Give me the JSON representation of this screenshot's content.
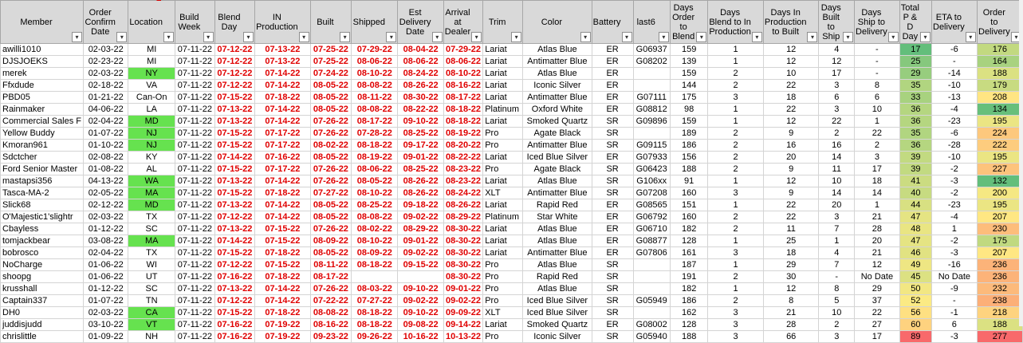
{
  "headers": [
    {
      "label": "Member",
      "filter": "▾"
    },
    {
      "label": "Order Confirm Date",
      "filter": "▾"
    },
    {
      "label": "Location",
      "filter": "▾"
    },
    {
      "label": "Build Week",
      "filter": "▾"
    },
    {
      "label": "Blend Day",
      "filter": "▾"
    },
    {
      "label": "IN Production",
      "filter": "▾"
    },
    {
      "label": "Built",
      "filter": "▾"
    },
    {
      "label": "Shipped",
      "filter": "▾"
    },
    {
      "label": "Est Delivery Date",
      "filter": "▾"
    },
    {
      "label": "Arrival at Dealer",
      "filter": "▾"
    },
    {
      "label": "Trim",
      "filter": "▾"
    },
    {
      "label": "Color",
      "filter": "▾"
    },
    {
      "label": "Battery",
      "filter": "▾"
    },
    {
      "label": "last6",
      "filter": "▾"
    },
    {
      "label": "Days Order to Blend",
      "filter": "▾"
    },
    {
      "label": "Days Blend to In Production",
      "filter": "▾"
    },
    {
      "label": "Days In Production to Built",
      "filter": "▾"
    },
    {
      "label": "Days Built to Ship",
      "filter": "▾"
    },
    {
      "label": "Days Ship to Delivery",
      "filter": "▾"
    },
    {
      "label": "Total P & D Day",
      "filter": "▾"
    },
    {
      "label": "ETA to Delivery",
      "filter": "▾"
    },
    {
      "label": "Order to Delivery",
      "filter": "▾"
    }
  ],
  "colors": {
    "red_text": "#e00000",
    "location_highlight": "#66e24f",
    "header_bg": "#d9d9d9"
  },
  "rows": [
    {
      "member": "awilli1010",
      "order": "02-03-22",
      "loc": "MI",
      "loc_hl": false,
      "week": "07-11-22",
      "blend": "07-12-22",
      "inprod": "07-13-22",
      "built": "07-25-22",
      "shipped": "07-29-22",
      "est": "08-04-22",
      "arrival": "07-29-22",
      "trim": "Lariat",
      "color": "Atlas Blue",
      "battery": "ER",
      "last6": "G06937",
      "d_order_blend": "159",
      "d_blend_prod": "1",
      "d_prod_built": "12",
      "d_built_ship": "4",
      "d_ship_del": "-",
      "total": "17",
      "eta": "-6",
      "otd": "176"
    },
    {
      "member": "DJSJOEKS",
      "order": "02-23-22",
      "loc": "MI",
      "loc_hl": false,
      "week": "07-11-22",
      "blend": "07-12-22",
      "inprod": "07-13-22",
      "built": "07-25-22",
      "shipped": "08-06-22",
      "est": "08-06-22",
      "arrival": "08-06-22",
      "trim": "Lariat",
      "color": "Antimatter Blue",
      "battery": "ER",
      "last6": "G08202",
      "d_order_blend": "139",
      "d_blend_prod": "1",
      "d_prod_built": "12",
      "d_built_ship": "12",
      "d_ship_del": "-",
      "total": "25",
      "eta": "-",
      "otd": "164"
    },
    {
      "member": "merek",
      "order": "02-03-22",
      "loc": "NY",
      "loc_hl": true,
      "week": "07-11-22",
      "blend": "07-12-22",
      "inprod": "07-14-22",
      "built": "07-24-22",
      "shipped": "08-10-22",
      "est": "08-24-22",
      "arrival": "08-10-22",
      "trim": "Lariat",
      "color": "Atlas Blue",
      "battery": "ER",
      "last6": "",
      "d_order_blend": "159",
      "d_blend_prod": "2",
      "d_prod_built": "10",
      "d_built_ship": "17",
      "d_ship_del": "-",
      "total": "29",
      "eta": "-14",
      "otd": "188"
    },
    {
      "member": "Ffxdude",
      "order": "02-18-22",
      "loc": "VA",
      "loc_hl": false,
      "week": "07-11-22",
      "blend": "07-12-22",
      "inprod": "07-14-22",
      "built": "08-05-22",
      "shipped": "08-08-22",
      "est": "08-26-22",
      "arrival": "08-16-22",
      "trim": "Lariat",
      "color": "Iconic Silver",
      "battery": "ER",
      "last6": "",
      "d_order_blend": "144",
      "d_blend_prod": "2",
      "d_prod_built": "22",
      "d_built_ship": "3",
      "d_ship_del": "8",
      "total": "35",
      "eta": "-10",
      "otd": "179"
    },
    {
      "member": "PBD05",
      "order": "01-21-22",
      "loc": "Can-On",
      "loc_hl": false,
      "week": "07-11-22",
      "blend": "07-15-22",
      "inprod": "07-18-22",
      "built": "08-05-22",
      "shipped": "08-11-22",
      "est": "08-30-22",
      "arrival": "08-17-22",
      "trim": "Lariat",
      "color": "Antimatter Blue",
      "battery": "ER",
      "last6": "G07111",
      "d_order_blend": "175",
      "d_blend_prod": "3",
      "d_prod_built": "18",
      "d_built_ship": "6",
      "d_ship_del": "6",
      "total": "33",
      "eta": "-13",
      "otd": "208"
    },
    {
      "member": "Rainmaker",
      "order": "04-06-22",
      "loc": "LA",
      "loc_hl": false,
      "week": "07-11-22",
      "blend": "07-13-22",
      "inprod": "07-14-22",
      "built": "08-05-22",
      "shipped": "08-08-22",
      "est": "08-22-22",
      "arrival": "08-18-22",
      "trim": "Platinum",
      "color": "Oxford White",
      "battery": "ER",
      "last6": "G08812",
      "d_order_blend": "98",
      "d_blend_prod": "1",
      "d_prod_built": "22",
      "d_built_ship": "3",
      "d_ship_del": "10",
      "total": "36",
      "eta": "-4",
      "otd": "134"
    },
    {
      "member": "Commercial Sales F",
      "order": "02-04-22",
      "loc": "MD",
      "loc_hl": true,
      "week": "07-11-22",
      "blend": "07-13-22",
      "inprod": "07-14-22",
      "built": "07-26-22",
      "shipped": "08-17-22",
      "est": "09-10-22",
      "arrival": "08-18-22",
      "trim": "Lariat",
      "color": "Smoked Quartz",
      "battery": "SR",
      "last6": "G09896",
      "d_order_blend": "159",
      "d_blend_prod": "1",
      "d_prod_built": "12",
      "d_built_ship": "22",
      "d_ship_del": "1",
      "total": "36",
      "eta": "-23",
      "otd": "195"
    },
    {
      "member": "Yellow Buddy",
      "order": "01-07-22",
      "loc": "NJ",
      "loc_hl": true,
      "week": "07-11-22",
      "blend": "07-15-22",
      "inprod": "07-17-22",
      "built": "07-26-22",
      "shipped": "07-28-22",
      "est": "08-25-22",
      "arrival": "08-19-22",
      "trim": "Pro",
      "color": "Agate Black",
      "battery": "SR",
      "last6": "",
      "d_order_blend": "189",
      "d_blend_prod": "2",
      "d_prod_built": "9",
      "d_built_ship": "2",
      "d_ship_del": "22",
      "total": "35",
      "eta": "-6",
      "otd": "224"
    },
    {
      "member": "Kmoran961",
      "order": "01-10-22",
      "loc": "NJ",
      "loc_hl": true,
      "week": "07-11-22",
      "blend": "07-15-22",
      "inprod": "07-17-22",
      "built": "08-02-22",
      "shipped": "08-18-22",
      "est": "09-17-22",
      "arrival": "08-20-22",
      "trim": "Pro",
      "color": "Antimatter Blue",
      "battery": "SR",
      "last6": "G09115",
      "d_order_blend": "186",
      "d_blend_prod": "2",
      "d_prod_built": "16",
      "d_built_ship": "16",
      "d_ship_del": "2",
      "total": "36",
      "eta": "-28",
      "otd": "222"
    },
    {
      "member": "Sdctcher",
      "order": "02-08-22",
      "loc": "KY",
      "loc_hl": false,
      "week": "07-11-22",
      "blend": "07-14-22",
      "inprod": "07-16-22",
      "built": "08-05-22",
      "shipped": "08-19-22",
      "est": "09-01-22",
      "arrival": "08-22-22",
      "trim": "Lariat",
      "color": "Iced Blue Silver",
      "battery": "ER",
      "last6": "G07933",
      "d_order_blend": "156",
      "d_blend_prod": "2",
      "d_prod_built": "20",
      "d_built_ship": "14",
      "d_ship_del": "3",
      "total": "39",
      "eta": "-10",
      "otd": "195"
    },
    {
      "member": "Ford Senior Master",
      "order": "01-08-22",
      "loc": "AL",
      "loc_hl": false,
      "week": "07-11-22",
      "blend": "07-15-22",
      "inprod": "07-17-22",
      "built": "07-26-22",
      "shipped": "08-06-22",
      "est": "08-25-22",
      "arrival": "08-23-22",
      "trim": "Pro",
      "color": "Agate Black",
      "battery": "SR",
      "last6": "G06423",
      "d_order_blend": "188",
      "d_blend_prod": "2",
      "d_prod_built": "9",
      "d_built_ship": "11",
      "d_ship_del": "17",
      "total": "39",
      "eta": "-2",
      "otd": "227"
    },
    {
      "member": "mastapsi356",
      "order": "04-13-22",
      "loc": "WA",
      "loc_hl": true,
      "week": "07-11-22",
      "blend": "07-13-22",
      "inprod": "07-14-22",
      "built": "07-26-22",
      "shipped": "08-05-22",
      "est": "08-26-22",
      "arrival": "08-23-22",
      "trim": "Lariat",
      "color": "Atlas Blue",
      "battery": "SR",
      "last6": "G106xx",
      "d_order_blend": "91",
      "d_blend_prod": "1",
      "d_prod_built": "12",
      "d_built_ship": "10",
      "d_ship_del": "18",
      "total": "41",
      "eta": "-3",
      "otd": "132"
    },
    {
      "member": "Tasca-MA-2",
      "order": "02-05-22",
      "loc": "MA",
      "loc_hl": true,
      "week": "07-11-22",
      "blend": "07-15-22",
      "inprod": "07-18-22",
      "built": "07-27-22",
      "shipped": "08-10-22",
      "est": "08-26-22",
      "arrival": "08-24-22",
      "trim": "XLT",
      "color": "Antimatter Blue",
      "battery": "SR",
      "last6": "G07208",
      "d_order_blend": "160",
      "d_blend_prod": "3",
      "d_prod_built": "9",
      "d_built_ship": "14",
      "d_ship_del": "14",
      "total": "40",
      "eta": "-2",
      "otd": "200"
    },
    {
      "member": "Slick68",
      "order": "02-12-22",
      "loc": "MD",
      "loc_hl": true,
      "week": "07-11-22",
      "blend": "07-13-22",
      "inprod": "07-14-22",
      "built": "08-05-22",
      "shipped": "08-25-22",
      "est": "09-18-22",
      "arrival": "08-26-22",
      "trim": "Lariat",
      "color": "Rapid Red",
      "battery": "ER",
      "last6": "G08565",
      "d_order_blend": "151",
      "d_blend_prod": "1",
      "d_prod_built": "22",
      "d_built_ship": "20",
      "d_ship_del": "1",
      "total": "44",
      "eta": "-23",
      "otd": "195"
    },
    {
      "member": "O'Majestic1'slightr",
      "order": "02-03-22",
      "loc": "TX",
      "loc_hl": false,
      "week": "07-11-22",
      "blend": "07-12-22",
      "inprod": "07-14-22",
      "built": "08-05-22",
      "shipped": "08-08-22",
      "est": "09-02-22",
      "arrival": "08-29-22",
      "trim": "Platinum",
      "color": "Star White",
      "battery": "ER",
      "last6": "G06792",
      "d_order_blend": "160",
      "d_blend_prod": "2",
      "d_prod_built": "22",
      "d_built_ship": "3",
      "d_ship_del": "21",
      "total": "47",
      "eta": "-4",
      "otd": "207"
    },
    {
      "member": "Cbayless",
      "order": "01-12-22",
      "loc": "SC",
      "loc_hl": false,
      "week": "07-11-22",
      "blend": "07-13-22",
      "inprod": "07-15-22",
      "built": "07-26-22",
      "shipped": "08-02-22",
      "est": "08-29-22",
      "arrival": "08-30-22",
      "trim": "Lariat",
      "color": "Atlas Blue",
      "battery": "ER",
      "last6": "G06710",
      "d_order_blend": "182",
      "d_blend_prod": "2",
      "d_prod_built": "11",
      "d_built_ship": "7",
      "d_ship_del": "28",
      "total": "48",
      "eta": "1",
      "otd": "230"
    },
    {
      "member": "tomjackbear",
      "order": "03-08-22",
      "loc": "MA",
      "loc_hl": true,
      "week": "07-11-22",
      "blend": "07-14-22",
      "inprod": "07-15-22",
      "built": "08-09-22",
      "shipped": "08-10-22",
      "est": "09-01-22",
      "arrival": "08-30-22",
      "trim": "Lariat",
      "color": "Atlas Blue",
      "battery": "ER",
      "last6": "G08877",
      "d_order_blend": "128",
      "d_blend_prod": "1",
      "d_prod_built": "25",
      "d_built_ship": "1",
      "d_ship_del": "20",
      "total": "47",
      "eta": "-2",
      "otd": "175"
    },
    {
      "member": "bobrosco",
      "order": "02-04-22",
      "loc": "TX",
      "loc_hl": false,
      "week": "07-11-22",
      "blend": "07-15-22",
      "inprod": "07-18-22",
      "built": "08-05-22",
      "shipped": "08-09-22",
      "est": "09-02-22",
      "arrival": "08-30-22",
      "trim": "Lariat",
      "color": "Antimatter Blue",
      "battery": "ER",
      "last6": "G07806",
      "d_order_blend": "161",
      "d_blend_prod": "3",
      "d_prod_built": "18",
      "d_built_ship": "4",
      "d_ship_del": "21",
      "total": "46",
      "eta": "-3",
      "otd": "207"
    },
    {
      "member": "NoCharge",
      "order": "01-06-22",
      "loc": "WI",
      "loc_hl": false,
      "week": "07-11-22",
      "blend": "07-12-22",
      "inprod": "07-15-22",
      "built": "08-11-22",
      "shipped": "08-18-22",
      "est": "09-15-22",
      "arrival": "08-30-22",
      "trim": "Pro",
      "color": "Atlas Blue",
      "battery": "SR",
      "last6": "",
      "d_order_blend": "187",
      "d_blend_prod": "1",
      "d_prod_built": "29",
      "d_built_ship": "7",
      "d_ship_del": "12",
      "total": "49",
      "eta": "-16",
      "otd": "236"
    },
    {
      "member": "shoopg",
      "order": "01-06-22",
      "loc": "UT",
      "loc_hl": false,
      "week": "07-11-22",
      "blend": "07-16-22",
      "inprod": "07-18-22",
      "built": "08-17-22",
      "shipped": "",
      "est": "",
      "arrival": "08-30-22",
      "trim": "Pro",
      "color": "Rapid Red",
      "battery": "SR",
      "last6": "",
      "d_order_blend": "191",
      "d_blend_prod": "2",
      "d_prod_built": "30",
      "d_built_ship": "-",
      "d_ship_del": "No Date",
      "total": "45",
      "eta": "No Date",
      "otd": "236"
    },
    {
      "member": "krusshall",
      "order": "01-12-22",
      "loc": "SC",
      "loc_hl": false,
      "week": "07-11-22",
      "blend": "07-13-22",
      "inprod": "07-14-22",
      "built": "07-26-22",
      "shipped": "08-03-22",
      "est": "09-10-22",
      "arrival": "09-01-22",
      "trim": "Pro",
      "color": "Atlas Blue",
      "battery": "SR",
      "last6": "",
      "d_order_blend": "182",
      "d_blend_prod": "1",
      "d_prod_built": "12",
      "d_built_ship": "8",
      "d_ship_del": "29",
      "total": "50",
      "eta": "-9",
      "otd": "232"
    },
    {
      "member": "Captain337",
      "order": "01-07-22",
      "loc": "TN",
      "loc_hl": false,
      "week": "07-11-22",
      "blend": "07-12-22",
      "inprod": "07-14-22",
      "built": "07-22-22",
      "shipped": "07-27-22",
      "est": "09-02-22",
      "arrival": "09-02-22",
      "trim": "Pro",
      "color": "Iced Blue Silver",
      "battery": "SR",
      "last6": "G05949",
      "d_order_blend": "186",
      "d_blend_prod": "2",
      "d_prod_built": "8",
      "d_built_ship": "5",
      "d_ship_del": "37",
      "total": "52",
      "eta": "-",
      "otd": "238"
    },
    {
      "member": "DH0",
      "order": "02-03-22",
      "loc": "CA",
      "loc_hl": true,
      "week": "07-11-22",
      "blend": "07-15-22",
      "inprod": "07-18-22",
      "built": "08-08-22",
      "shipped": "08-18-22",
      "est": "09-10-22",
      "arrival": "09-09-22",
      "trim": "XLT",
      "color": "Iced Blue Silver",
      "battery": "SR",
      "last6": "",
      "d_order_blend": "162",
      "d_blend_prod": "3",
      "d_prod_built": "21",
      "d_built_ship": "10",
      "d_ship_del": "22",
      "total": "56",
      "eta": "-1",
      "otd": "218"
    },
    {
      "member": "juddisjudd",
      "order": "03-10-22",
      "loc": "VT",
      "loc_hl": true,
      "week": "07-11-22",
      "blend": "07-16-22",
      "inprod": "07-19-22",
      "built": "08-16-22",
      "shipped": "08-18-22",
      "est": "09-08-22",
      "arrival": "09-14-22",
      "trim": "Lariat",
      "color": "Smoked Quartz",
      "battery": "ER",
      "last6": "G08002",
      "d_order_blend": "128",
      "d_blend_prod": "3",
      "d_prod_built": "28",
      "d_built_ship": "2",
      "d_ship_del": "27",
      "total": "60",
      "eta": "6",
      "otd": "188"
    },
    {
      "member": "chrislittle",
      "order": "01-09-22",
      "loc": "NH",
      "loc_hl": false,
      "week": "07-11-22",
      "blend": "07-16-22",
      "inprod": "07-19-22",
      "built": "09-23-22",
      "shipped": "09-26-22",
      "est": "10-16-22",
      "arrival": "10-13-22",
      "trim": "Pro",
      "color": "Iconic Silver",
      "battery": "SR",
      "last6": "G05940",
      "d_order_blend": "188",
      "d_blend_prod": "3",
      "d_prod_built": "66",
      "d_built_ship": "3",
      "d_ship_del": "17",
      "total": "89",
      "eta": "-3",
      "otd": "277"
    }
  ]
}
